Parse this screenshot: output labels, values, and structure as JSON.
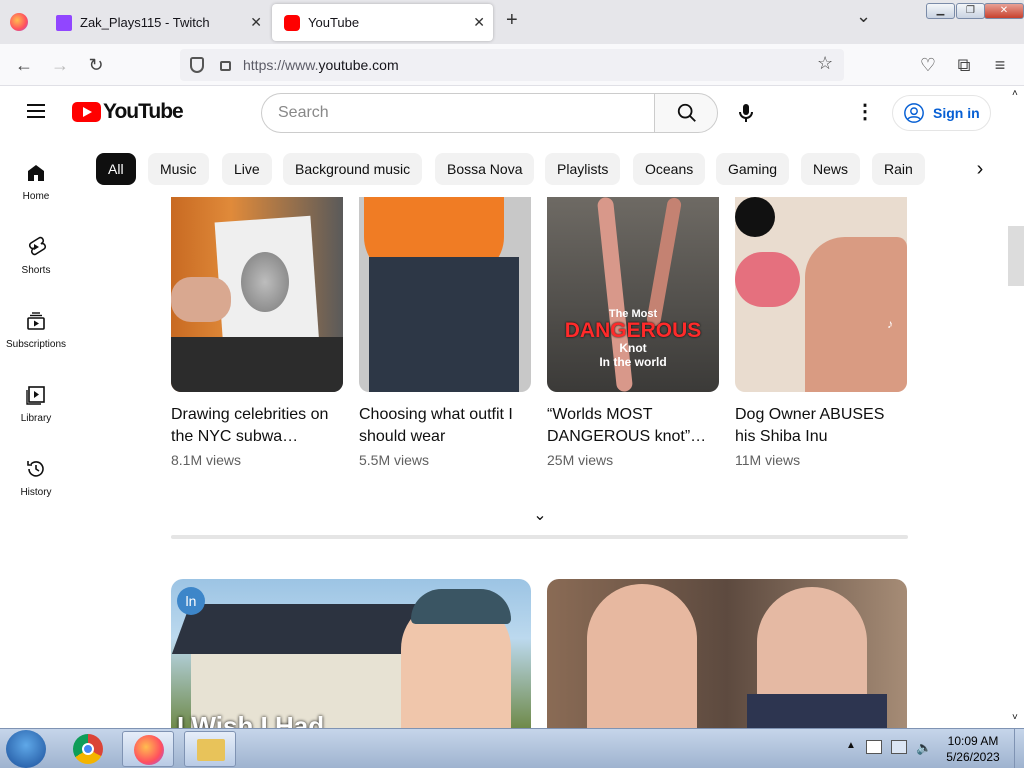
{
  "browser": {
    "tabs": [
      {
        "title": "Zak_Plays115 - Twitch"
      },
      {
        "title": "YouTube"
      }
    ],
    "url_prefix": "https://www.",
    "url_domain": "youtube.com",
    "new_tab": "+",
    "tab_list": "⌄"
  },
  "header": {
    "logo": "YouTube",
    "search_placeholder": "Search",
    "sign_in": "Sign in"
  },
  "chips": [
    "All",
    "Music",
    "Live",
    "Background music",
    "Bossa Nova",
    "Playlists",
    "Oceans",
    "Gaming",
    "News",
    "Rain"
  ],
  "sidebar": [
    {
      "label": "Home",
      "icon": "home-icon"
    },
    {
      "label": "Shorts",
      "icon": "shorts-icon"
    },
    {
      "label": "Subscriptions",
      "icon": "subscriptions-icon"
    },
    {
      "label": "Library",
      "icon": "library-icon"
    },
    {
      "label": "History",
      "icon": "history-icon"
    }
  ],
  "shorts": [
    {
      "title": "Drawing celebrities on the NYC subwa…",
      "views": "8.1M views"
    },
    {
      "title": "Choosing what outfit I should wear",
      "views": "5.5M views"
    },
    {
      "title": "“Worlds MOST DANGEROUS knot”…",
      "views": "25M views",
      "overlay": [
        "The Most",
        "DANGEROUS",
        "Knot",
        "In the world"
      ]
    },
    {
      "title": "Dog Owner ABUSES his Shiba Inu",
      "views": "11M views"
    }
  ],
  "big_thumbs": [
    {
      "overlay": "I Wish I Had"
    },
    {
      "overlay": ""
    }
  ],
  "taskbar": {
    "time": "10:09 AM",
    "date": "5/26/2023"
  },
  "colors": {
    "accent": "#ff0000",
    "link": "#065fd4"
  }
}
